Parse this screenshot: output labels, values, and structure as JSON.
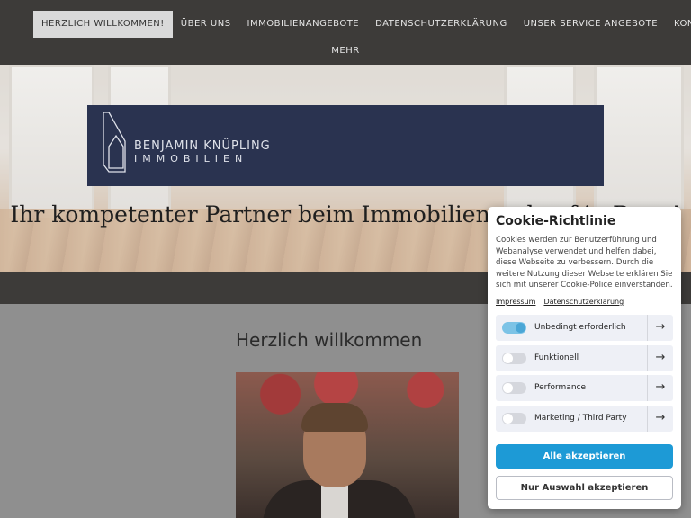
{
  "nav": {
    "items": [
      {
        "label": "HERZLICH WILLKOMMEN!",
        "active": true
      },
      {
        "label": "ÜBER UNS"
      },
      {
        "label": "IMMOBILIENANGEBOTE"
      },
      {
        "label": "DATENSCHUTZERKLÄRUNG"
      },
      {
        "label": "UNSER SERVICE ANGEBOTE"
      },
      {
        "label": "KONTAKT"
      }
    ],
    "more": "MEHR"
  },
  "hero": {
    "logo_line1": "BENJAMIN KNÜPLING",
    "logo_line2": "IMMOBILIEN",
    "tagline": "Ihr kompetenter Partner beim Immobilienverkauf in Bonn!"
  },
  "main": {
    "welcome": "Herzlich willkommen"
  },
  "cookie": {
    "title": "Cookie-Richtlinie",
    "text": "Cookies werden zur Benutzerführung und Webanalyse verwendet und helfen dabei, diese Webseite zu verbessern. Durch die weitere Nutzung dieser Webseite erklären Sie sich mit unserer Cookie-Police einverstanden.",
    "links": [
      "Impressum",
      "Datenschutzerklärung"
    ],
    "categories": [
      {
        "label": "Unbedingt erforderlich",
        "enabled": true
      },
      {
        "label": "Funktionell",
        "enabled": false
      },
      {
        "label": "Performance",
        "enabled": false
      },
      {
        "label": "Marketing / Third Party",
        "enabled": false
      }
    ],
    "accept_all": "Alle akzeptieren",
    "accept_selection": "Nur Auswahl akzeptieren"
  },
  "colors": {
    "nav_bg": "#3d3b39",
    "logo_bg": "#2a3350",
    "accent": "#1d9ad6"
  }
}
